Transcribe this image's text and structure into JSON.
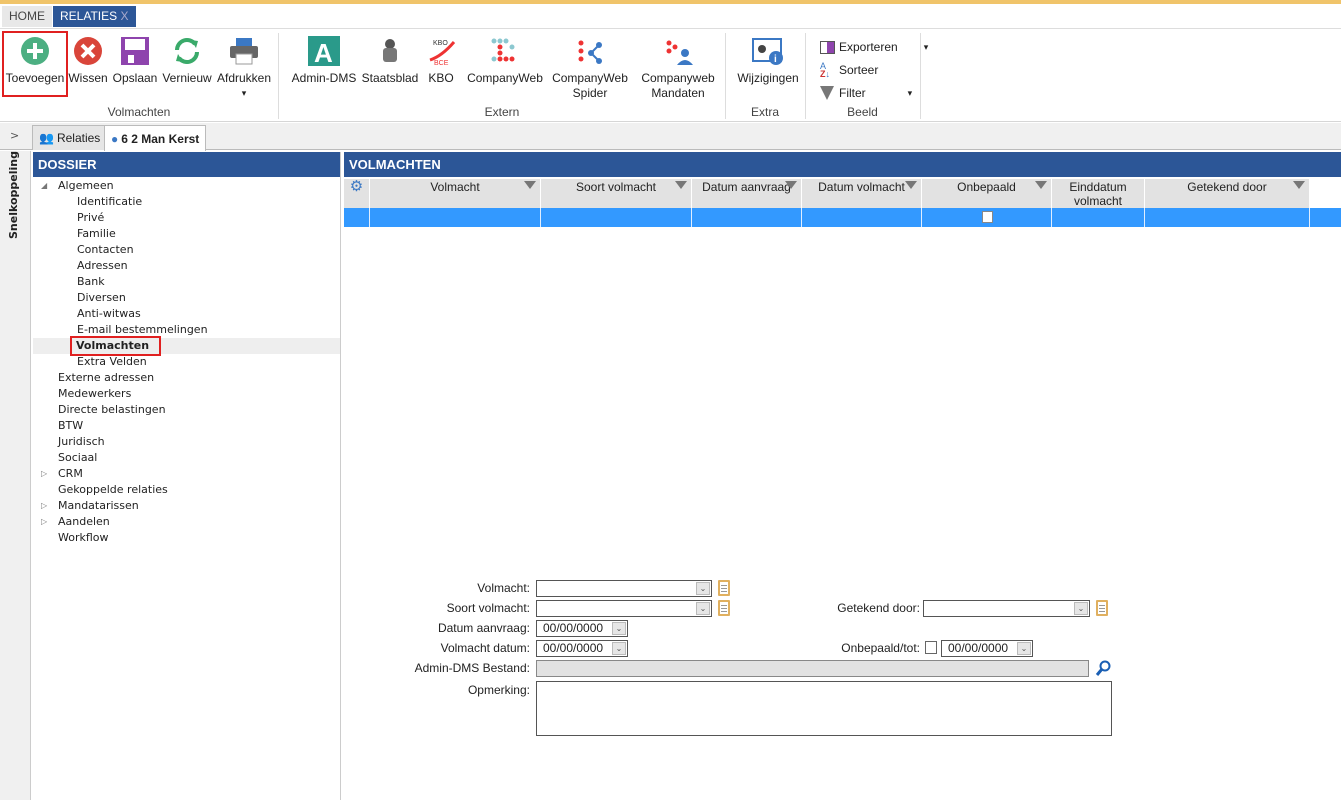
{
  "app_tabs": [
    {
      "label": "HOME"
    },
    {
      "label": "RELATIES",
      "close": "X"
    }
  ],
  "ribbon": {
    "volmachten": {
      "group": "Volmachten",
      "buttons": [
        {
          "label": "Toevoegen",
          "icon": "plus-circle-icon",
          "color": "#4caf82"
        },
        {
          "label": "Wissen",
          "icon": "delete-icon",
          "color": "#d9453a"
        },
        {
          "label": "Opslaan",
          "icon": "save-icon",
          "color": "#8e44ad"
        },
        {
          "label": "Vernieuw",
          "icon": "refresh-icon",
          "color": "#3aaa6a"
        },
        {
          "label": "Afdrukken",
          "icon": "printer-icon",
          "color": "#3b78c4",
          "arrow": "▾"
        }
      ]
    },
    "extern": {
      "group": "Extern",
      "buttons": [
        {
          "label": "Admin-DMS",
          "icon": "admin-dms-logo"
        },
        {
          "label": "Staatsblad",
          "icon": "coat-of-arms-icon"
        },
        {
          "label": "KBO",
          "icon": "kbo-logo"
        },
        {
          "label": "CompanyWeb",
          "icon": "companyweb-logo"
        },
        {
          "label": "CompanyWeb",
          "label2": "Spider",
          "icon": "companyweb-spider-logo"
        },
        {
          "label": "Companyweb",
          "label2": "Mandaten",
          "icon": "companyweb-mandaten-logo"
        }
      ]
    },
    "extra": {
      "group": "Extra",
      "buttons": [
        {
          "label": "Wijzigingen",
          "icon": "contact-info-icon"
        }
      ]
    },
    "beeld": {
      "group": "Beeld",
      "items": [
        {
          "label": "Exporteren",
          "icon": "export-icon",
          "arrow": "▾"
        },
        {
          "label": "Sorteer",
          "icon": "sort-az-icon"
        },
        {
          "label": "Filter",
          "icon": "filter-icon",
          "arrow": "▾"
        }
      ]
    }
  },
  "doc_tabs": {
    "toggle": ">",
    "tabs": [
      {
        "label": "Relaties",
        "icon": "users-icon"
      },
      {
        "label": "6 2 Man Kerst",
        "icon": "user-icon",
        "active": true
      }
    ]
  },
  "sidebar_strip": {
    "label": "Snelkoppeling"
  },
  "dossier": {
    "title": "DOSSIER",
    "items": [
      {
        "label": "Algemeen",
        "level": 0,
        "expander": "◢"
      },
      {
        "label": "Identificatie",
        "level": 1
      },
      {
        "label": "Privé",
        "level": 1
      },
      {
        "label": "Familie",
        "level": 1
      },
      {
        "label": "Contacten",
        "level": 1
      },
      {
        "label": "Adressen",
        "level": 1
      },
      {
        "label": "Bank",
        "level": 1
      },
      {
        "label": "Diversen",
        "level": 1
      },
      {
        "label": "Anti-witwas",
        "level": 1
      },
      {
        "label": "E-mail bestemmelingen",
        "level": 1
      },
      {
        "label": "Volmachten",
        "level": 1,
        "selected": true
      },
      {
        "label": "Extra Velden",
        "level": 1
      },
      {
        "label": "Externe adressen",
        "level": 0
      },
      {
        "label": "Medewerkers",
        "level": 0
      },
      {
        "label": "Directe belastingen",
        "level": 0
      },
      {
        "label": "BTW",
        "level": 0
      },
      {
        "label": "Juridisch",
        "level": 0
      },
      {
        "label": "Sociaal",
        "level": 0
      },
      {
        "label": "CRM",
        "level": 0,
        "expander": "▷"
      },
      {
        "label": "Gekoppelde relaties",
        "level": 0
      },
      {
        "label": "Mandatarissen",
        "level": 0,
        "expander": "▷"
      },
      {
        "label": "Aandelen",
        "level": 0,
        "expander": "▷"
      },
      {
        "label": "Workflow",
        "level": 0
      }
    ]
  },
  "volmachten": {
    "title": "VOLMACHTEN",
    "columns": [
      "Volmacht",
      "Soort volmacht",
      "Datum aanvraag",
      "Datum volmacht",
      "Onbepaald",
      "Einddatum volmacht",
      "Getekend door"
    ],
    "selected_color": "#3399ff"
  },
  "form": {
    "volmacht": {
      "label": "Volmacht:",
      "value": ""
    },
    "soort": {
      "label": "Soort volmacht:",
      "value": ""
    },
    "getekend": {
      "label": "Getekend door:",
      "value": ""
    },
    "datum_aanvraag": {
      "label": "Datum aanvraag:",
      "value": "00/00/0000"
    },
    "volmacht_datum": {
      "label": "Volmacht datum:",
      "value": "00/00/0000"
    },
    "onbepaald": {
      "label": "Onbepaald/tot:",
      "checked": false,
      "value": "00/00/0000"
    },
    "admin_dms": {
      "label": "Admin-DMS Bestand:",
      "value": ""
    },
    "opmerking": {
      "label": "Opmerking:",
      "value": ""
    }
  }
}
